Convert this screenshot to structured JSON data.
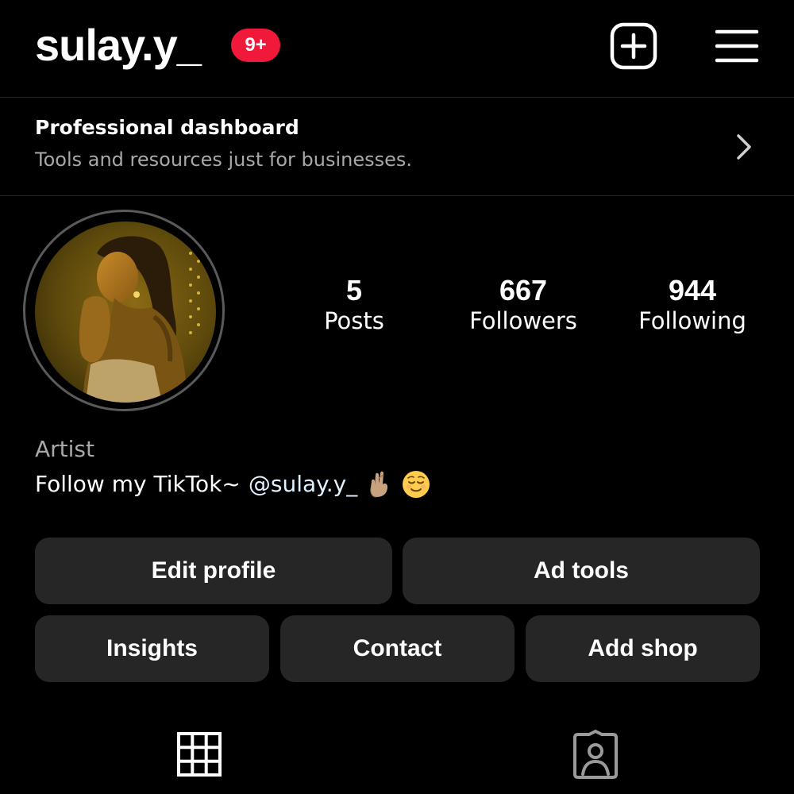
{
  "header": {
    "username": "sulay.y_",
    "notification_badge": "9+",
    "new_post_icon": "plus-square-icon",
    "menu_icon": "hamburger-menu-icon"
  },
  "dashboard": {
    "title": "Professional dashboard",
    "subtitle": "Tools and resources just for businesses.",
    "chevron_icon": "chevron-right-icon"
  },
  "profile": {
    "avatar": "profile-photo",
    "stats": {
      "posts": {
        "value": "5",
        "label": "Posts"
      },
      "followers": {
        "value": "667",
        "label": "Followers"
      },
      "following": {
        "value": "944",
        "label": "Following"
      }
    },
    "category": "Artist",
    "bio": {
      "text": "Follow my TikTok~",
      "mention": "@sulay.y_",
      "emojis": [
        "crossed-fingers-emoji",
        "relieved-face-emoji"
      ]
    }
  },
  "actions": {
    "edit_profile": "Edit profile",
    "ad_tools": "Ad tools",
    "insights": "Insights",
    "contact": "Contact",
    "add_shop": "Add shop"
  },
  "tabs": [
    {
      "icon": "grid-icon",
      "selected": true
    },
    {
      "icon": "tagged-person-icon",
      "selected": false
    }
  ],
  "colors": {
    "background": "#000000",
    "button": "#262626",
    "badge": "#f0193a",
    "secondary_text": "#a8a8a8",
    "mention": "#e0f1ff"
  }
}
